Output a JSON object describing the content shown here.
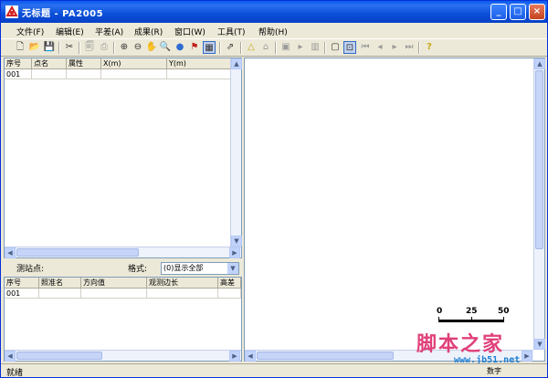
{
  "window": {
    "title": "无标题 - PA2005",
    "min_label": "_",
    "max_label": "□",
    "close_label": "×"
  },
  "menu": {
    "items": [
      {
        "label": "文件(F)"
      },
      {
        "label": "编辑(E)"
      },
      {
        "label": "平差(A)"
      },
      {
        "label": "成果(R)"
      },
      {
        "label": "窗口(W)"
      },
      {
        "label": "工具(T)"
      },
      {
        "label": "帮助(H)"
      }
    ]
  },
  "toolbar": {
    "icons": [
      {
        "name": "new-file-icon",
        "glyph": "🗋"
      },
      {
        "name": "open-folder-icon",
        "glyph": "📂"
      },
      {
        "name": "save-icon",
        "glyph": "💾"
      },
      {
        "name": "cut-icon",
        "glyph": "✂"
      },
      {
        "name": "print-preview-icon",
        "glyph": "🗐"
      },
      {
        "name": "print-icon",
        "glyph": "⎙"
      },
      {
        "name": "zoom-in-icon",
        "glyph": "⊕"
      },
      {
        "name": "zoom-out-icon",
        "glyph": "⊖"
      },
      {
        "name": "pan-hand-icon",
        "glyph": "✋"
      },
      {
        "name": "zoom-window-icon",
        "glyph": "🔍"
      },
      {
        "name": "globe-icon",
        "glyph": "●"
      },
      {
        "name": "flag-icon",
        "glyph": "⚑"
      },
      {
        "name": "grid-view-icon",
        "glyph": "▦"
      },
      {
        "name": "export-icon",
        "glyph": "⇗"
      },
      {
        "name": "triangle-icon",
        "glyph": "△"
      },
      {
        "name": "network-icon",
        "glyph": "⌂"
      },
      {
        "name": "calc-icon",
        "glyph": "▣"
      },
      {
        "name": "play-icon",
        "glyph": "▸"
      },
      {
        "name": "chart-icon",
        "glyph": "▥"
      },
      {
        "name": "page-icon",
        "glyph": "▢"
      },
      {
        "name": "page-select-icon",
        "glyph": "⊡"
      },
      {
        "name": "first-page-icon",
        "glyph": "⏮"
      },
      {
        "name": "prev-page-icon",
        "glyph": "◂"
      },
      {
        "name": "next-page-icon",
        "glyph": "▸"
      },
      {
        "name": "last-page-icon",
        "glyph": "⏭"
      },
      {
        "name": "help-icon",
        "glyph": "?"
      }
    ]
  },
  "point_table": {
    "columns": [
      "序号",
      "点名",
      "属性",
      "X(m)",
      "Y(m)"
    ],
    "rows": [
      [
        "001",
        "",
        "",
        "",
        ""
      ]
    ]
  },
  "station": {
    "label": "测站点:",
    "format_label": "格式:",
    "format_value": "(0)显示全部"
  },
  "obs_table": {
    "columns": [
      "序号",
      "照准名",
      "方向值",
      "观测边长",
      "高差"
    ],
    "rows": [
      [
        "001",
        "",
        "",
        "",
        ""
      ]
    ]
  },
  "scale_bar": {
    "ticks": [
      "0",
      "25",
      "50"
    ]
  },
  "status": {
    "text": "就绪",
    "mode": "数字"
  },
  "watermark": {
    "text": "脚本之家",
    "sub": "www.jb51.net"
  }
}
